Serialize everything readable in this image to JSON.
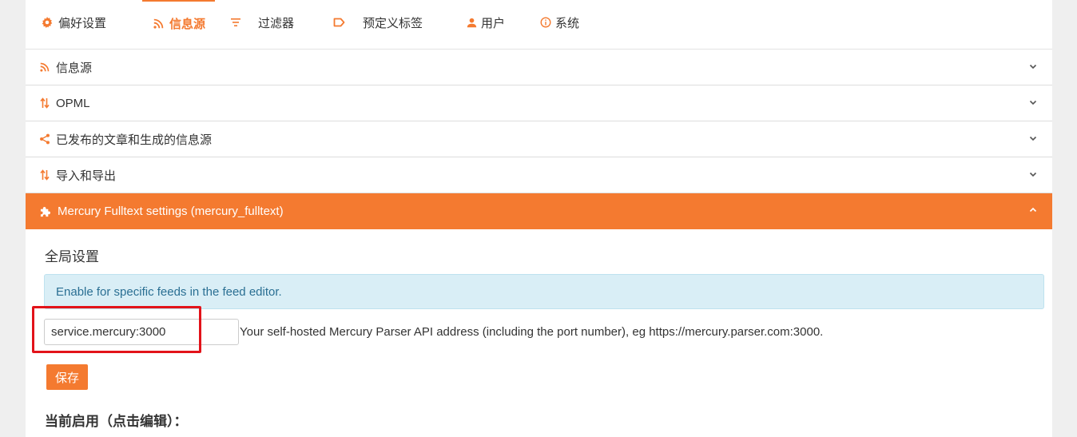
{
  "tabs": [
    {
      "label": "偏好设置",
      "icon": "gear-icon"
    },
    {
      "label": "信息源",
      "icon": "rss-icon"
    },
    {
      "label": "过滤器",
      "icon": "filter-icon"
    },
    {
      "label": "预定义标签",
      "icon": "label-icon"
    },
    {
      "label": "用户",
      "icon": "user-icon"
    },
    {
      "label": "系统",
      "icon": "info-icon"
    }
  ],
  "active_tab": "信息源",
  "sections": [
    {
      "label": "信息源",
      "icon": "rss-icon"
    },
    {
      "label": "OPML",
      "icon": "import-export-icon"
    },
    {
      "label": "已发布的文章和生成的信息源",
      "icon": "share-icon"
    },
    {
      "label": "导入和导出",
      "icon": "import-export-icon"
    },
    {
      "label": "Mercury Fulltext settings (mercury_fulltext)",
      "icon": "puzzle-icon"
    }
  ],
  "open_section": "Mercury Fulltext settings (mercury_fulltext)",
  "mercury": {
    "global_title": "全局设置",
    "alert": "Enable for specific feeds in the feed editor.",
    "api_value": "service.mercury:3000",
    "api_help": "Your self-hosted Mercury Parser API address (including the port number), eg https://mercury.parser.com:3000.",
    "save_label": "保存",
    "current_title": "当前启用（点击编辑）："
  },
  "colors": {
    "accent": "#f47a30",
    "alert_bg": "#d9eef6",
    "alert_text": "#2a6f93",
    "highlight": "#e2131a"
  }
}
